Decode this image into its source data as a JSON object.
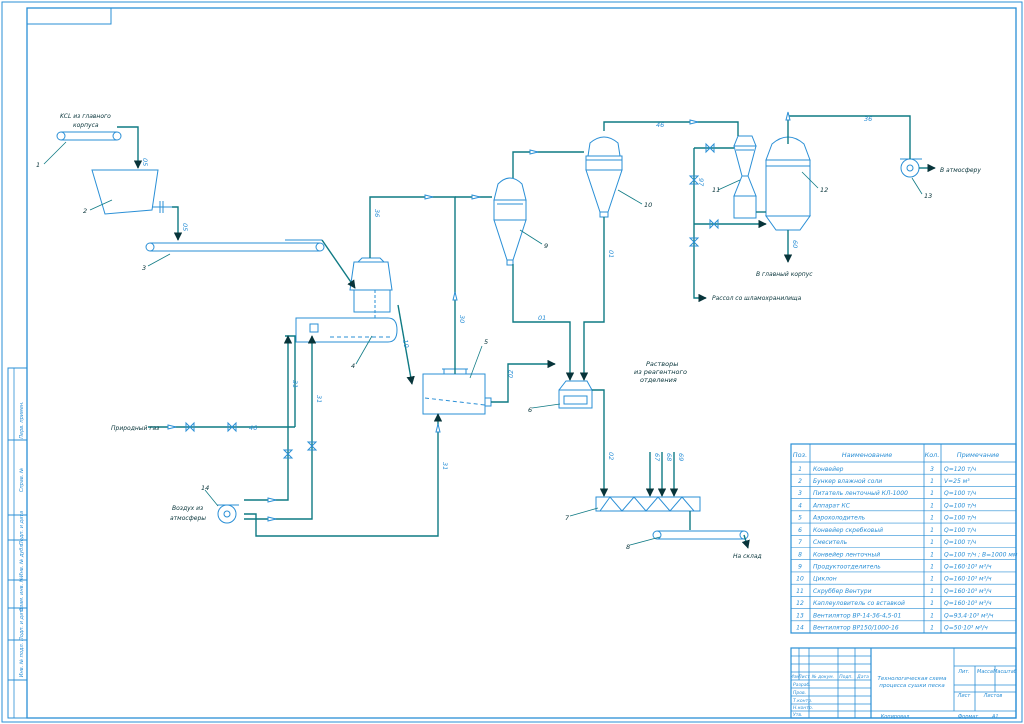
{
  "title_block": {
    "caption": [
      "Технологическая схема",
      "процесса сушки песка"
    ],
    "lit": "Лит.",
    "mass": "Масса",
    "scale": "Масштаб",
    "sheet": "Лист",
    "sheets": "Листов",
    "copied": "Копировал",
    "format_label": "Формат",
    "format_value": "A1",
    "rev_headers": [
      "Изм",
      "Лист",
      "№ докум.",
      "Подп.",
      "Дата"
    ],
    "roles": [
      "Разраб.",
      "Пров.",
      "Т.контр.",
      "",
      "Н.контр.",
      "Утв."
    ]
  },
  "side_stamp": [
    "Перв. примен.",
    "Справ. №",
    "Подп. и дата",
    "Инв. № дубл.",
    "Взам. инв. №",
    "Подп. и дата",
    "Инв. № подл."
  ],
  "spec_table": {
    "headers": [
      "Поз.",
      "Наименование",
      "Кол.",
      "Примечание"
    ],
    "rows": [
      {
        "pos": "1",
        "name": "Конвейер",
        "qty": "3",
        "note": "Q=120 т/ч"
      },
      {
        "pos": "2",
        "name": "Бункер влажной соли",
        "qty": "1",
        "note": "V=25 м³"
      },
      {
        "pos": "3",
        "name": "Питатель ленточный КЛ-1000",
        "qty": "1",
        "note": "Q=100 т/ч"
      },
      {
        "pos": "4",
        "name": "Аппарат КС",
        "qty": "1",
        "note": "Q=100 т/ч"
      },
      {
        "pos": "5",
        "name": "Аэрохолодитель",
        "qty": "1",
        "note": "Q=100 т/ч"
      },
      {
        "pos": "6",
        "name": "Конвейер скребковый",
        "qty": "1",
        "note": "Q=100 т/ч"
      },
      {
        "pos": "7",
        "name": "Смеситель",
        "qty": "1",
        "note": "Q=100 т/ч"
      },
      {
        "pos": "8",
        "name": "Конвейер ленточный",
        "qty": "1",
        "note": "Q=100 т/ч ; B=1000 мм"
      },
      {
        "pos": "9",
        "name": "Продуктоотделитель",
        "qty": "1",
        "note": "Q=160·10³ м³/ч"
      },
      {
        "pos": "10",
        "name": "Циклон",
        "qty": "1",
        "note": "Q=160·10³ м³/ч"
      },
      {
        "pos": "11",
        "name": "Скруббер Вентури",
        "qty": "1",
        "note": "Q=160·10³ м³/ч"
      },
      {
        "pos": "12",
        "name": "Каплеуловитель со вставкой",
        "qty": "1",
        "note": "Q=160·10³ м³/ч"
      },
      {
        "pos": "13",
        "name": "Вентилятор ВР-14-36-4,5-01",
        "qty": "1",
        "note": "Q=93,4·10³ м³/ч"
      },
      {
        "pos": "14",
        "name": "Вентилятор ВР150/1000-16",
        "qty": "1",
        "note": "Q=50·10³ м³/ч"
      }
    ]
  },
  "notes": {
    "kcl_source": [
      "KCL из главного",
      "корпуса"
    ],
    "natural_gas": "Природный газ",
    "air": [
      "Воздух из",
      "атмосферы"
    ],
    "solutions": [
      "Растворы",
      "из реагентного",
      "отделения"
    ],
    "to_warehouse": "На склад",
    "to_atmosphere": "В атмосферу",
    "to_main_building": "В главный корпус",
    "brine": "Рассол со шламохранилища"
  },
  "positions": [
    "1",
    "2",
    "3",
    "4",
    "5",
    "6",
    "7",
    "8",
    "9",
    "10",
    "11",
    "12",
    "13",
    "14"
  ],
  "line_codes": {
    "l05a": "05",
    "l05b": "05",
    "l36a": "36",
    "l30": "30",
    "l10": "10",
    "l01a": "01",
    "l01b": "01",
    "l01c": "01",
    "l02a": "02",
    "l02b": "02",
    "l46": "46",
    "l36b": "36",
    "l97": "97",
    "l60": "60",
    "l31a": "31",
    "l31b": "31",
    "l31c": "31",
    "l46gas": "46",
    "l67": "67",
    "l68": "68",
    "l69": "69"
  },
  "colors": {
    "frame": "#2a8fd6",
    "line": "#0f7a84",
    "arrow": "#08343a"
  }
}
